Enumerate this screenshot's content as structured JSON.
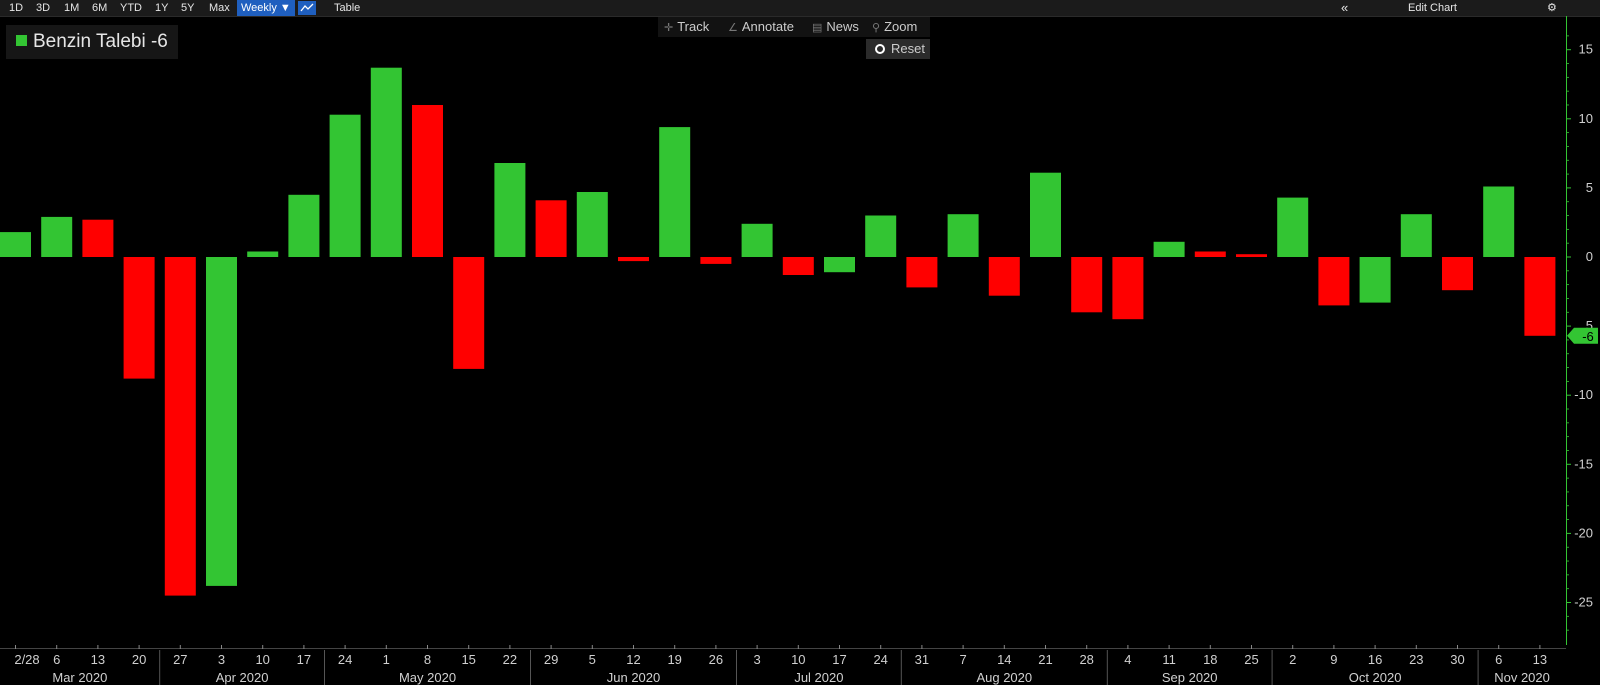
{
  "toolbar": {
    "ranges": [
      "1D",
      "3D",
      "1M",
      "6M",
      "YTD",
      "1Y",
      "5Y",
      "Max"
    ],
    "frequency": "Weekly ▼",
    "table_label": "Table",
    "collapse_label": "«",
    "edit_chart_label": "Edit Chart",
    "settings_label": "⚙"
  },
  "controls": {
    "track": "Track",
    "annotate": "Annotate",
    "news": "News",
    "zoom": "Zoom",
    "reset": "Reset"
  },
  "legend": {
    "label": "Benzin Talebi -6",
    "color": "#33c533"
  },
  "colors": {
    "up": "#33c533",
    "down": "#ff0000",
    "axis": "#33c533"
  },
  "chart_data": {
    "type": "bar",
    "series_name": "Benzin Talebi",
    "last_value_label": "-6",
    "x_tick_labels": [
      "2/28",
      "6",
      "13",
      "20",
      "27",
      "3",
      "10",
      "17",
      "24",
      "1",
      "8",
      "15",
      "22",
      "29",
      "5",
      "12",
      "19",
      "26",
      "3",
      "10",
      "17",
      "24",
      "31",
      "7",
      "14",
      "21",
      "28",
      "4",
      "11",
      "18",
      "25",
      "2",
      "9",
      "16",
      "23",
      "30",
      "6",
      "13"
    ],
    "values": [
      1.8,
      2.9,
      2.7,
      -8.8,
      -24.5,
      -23.8,
      0.4,
      4.5,
      10.3,
      13.7,
      11.0,
      -8.1,
      6.8,
      4.1,
      4.7,
      -0.3,
      9.4,
      -0.5,
      2.4,
      -1.3,
      -1.1,
      3.0,
      -2.2,
      3.1,
      -2.8,
      6.1,
      -4.0,
      -4.5,
      1.1,
      0.4,
      0.2,
      4.3,
      -3.5,
      -3.3,
      3.1,
      -2.4,
      5.1,
      -5.7
    ],
    "bar_colors": [
      "green",
      "green",
      "red",
      "red",
      "red",
      "green",
      "green",
      "green",
      "green",
      "green",
      "red",
      "red",
      "green",
      "red",
      "green",
      "red",
      "green",
      "red",
      "green",
      "red",
      "green",
      "green",
      "red",
      "green",
      "red",
      "green",
      "red",
      "red",
      "green",
      "red",
      "red",
      "green",
      "red",
      "green",
      "green",
      "red",
      "green",
      "red"
    ],
    "months": [
      {
        "label": "Mar 2020",
        "start_index": 0
      },
      {
        "label": "Apr 2020",
        "start_index": 4
      },
      {
        "label": "May 2020",
        "start_index": 8
      },
      {
        "label": "Jun 2020",
        "start_index": 13
      },
      {
        "label": "Jul 2020",
        "start_index": 18
      },
      {
        "label": "Aug 2020",
        "start_index": 22
      },
      {
        "label": "Sep 2020",
        "start_index": 27
      },
      {
        "label": "Oct 2020",
        "start_index": 31
      },
      {
        "label": "Nov 2020",
        "start_index": 36
      }
    ],
    "y_ticks": [
      15,
      10,
      5,
      0,
      -5,
      -10,
      -15,
      -20,
      -25
    ],
    "y_tick_labels": [
      "15",
      "10",
      "5",
      "0",
      "5",
      "-10",
      "-15",
      "-20",
      "-25"
    ],
    "ylim": [
      -28,
      17
    ],
    "grid": false
  }
}
